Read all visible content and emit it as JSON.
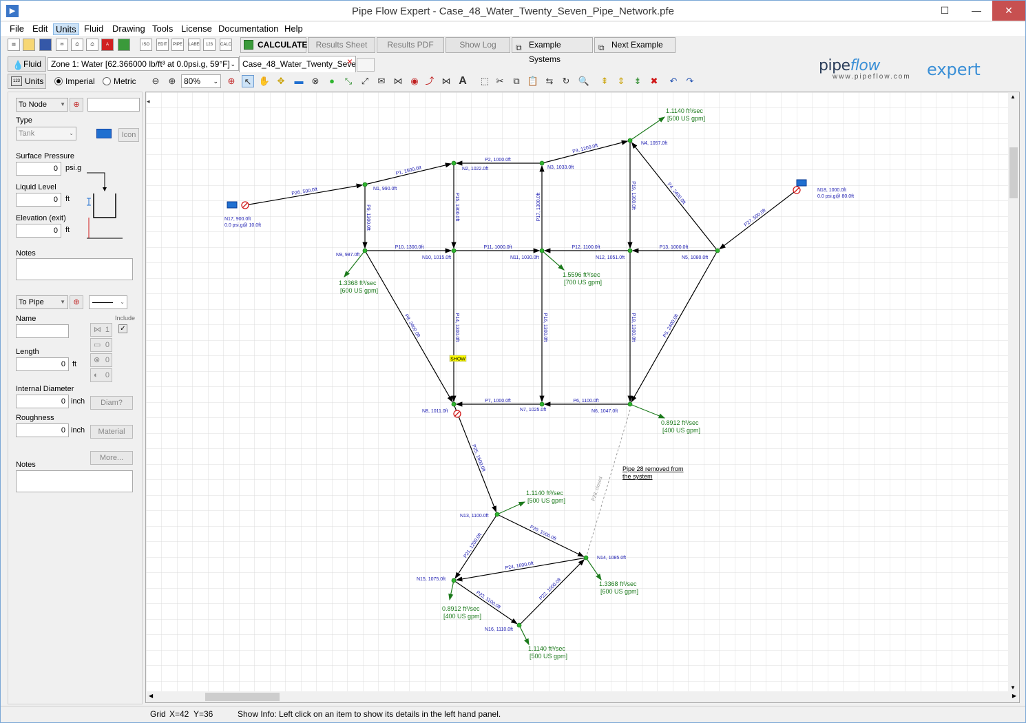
{
  "window": {
    "title": "Pipe Flow Expert - Case_48_Water_Twenty_Seven_Pipe_Network.pfe"
  },
  "menu": [
    {
      "label": "File"
    },
    {
      "label": "Edit"
    },
    {
      "label": "Units"
    },
    {
      "label": "Fluid"
    },
    {
      "label": "Drawing"
    },
    {
      "label": "Tools"
    },
    {
      "label": "License"
    },
    {
      "label": "Documentation"
    },
    {
      "label": "Help"
    }
  ],
  "toolbar": {
    "icons": [
      "new-icon",
      "open-icon",
      "save-icon",
      "email-icon",
      "print-preview-icon",
      "print-icon",
      "pdf-icon",
      "export-icon",
      "iso-icon",
      "edit-icon",
      "pipe-icon",
      "label-icon",
      "number-icon",
      "calc-icon"
    ],
    "icon_texts": {
      "iso": "ISO",
      "edit": "EDIT",
      "pipe": "PIPE",
      "label": "LABEL",
      "num": "123",
      "calc": "CALC"
    },
    "calculate": "CALCULATE",
    "results_sheet": "Results Sheet",
    "results_pdf": "Results PDF",
    "show_log": "Show Log",
    "example_systems": "Example Systems",
    "next_example": "Next Example"
  },
  "fluid": {
    "button": "Fluid",
    "zone": "Zone 1: Water [62.366000 lb/ft³ at 0.0psi.g, 59°F]"
  },
  "tab": {
    "label": "Case_48_Water_Twenty_Seve"
  },
  "units": {
    "button": "Units",
    "imperial": "Imperial",
    "metric": "Metric",
    "zoom": "80%"
  },
  "logo": {
    "pipe": "pipe",
    "flow": "flow",
    "expert": "expert",
    "url": "www.pipeflow.com"
  },
  "node_panel": {
    "to_node": "To Node",
    "type_label": "Type",
    "type_value": "Tank",
    "icon_button": "Icon",
    "surface_pressure_label": "Surface Pressure",
    "surface_pressure": "0",
    "surface_pressure_unit": "psi.g",
    "liquid_level_label": "Liquid Level",
    "liquid_level": "0",
    "liquid_level_unit": "ft",
    "elevation_label": "Elevation (exit)",
    "elevation": "0",
    "elevation_unit": "ft",
    "notes_label": "Notes"
  },
  "pipe_panel": {
    "to_pipe": "To Pipe",
    "name_label": "Name",
    "include_label": "Include",
    "length_label": "Length",
    "length": "0",
    "length_unit": "ft",
    "diameter_label": "Internal Diameter",
    "diameter": "0",
    "diameter_unit": "inch",
    "diam_button": "Diam?",
    "roughness_label": "Roughness",
    "roughness": "0",
    "roughness_unit": "inch",
    "material_button": "Material",
    "more_button": "More...",
    "notes_label": "Notes",
    "counts": [
      "1",
      "0",
      "0",
      "0"
    ]
  },
  "status": {
    "grid": "Grid",
    "x": "X=42",
    "y": "Y=36",
    "info": "Show Info: Left click on an item to show its details in the left hand panel."
  },
  "network": {
    "nodes": [
      {
        "id": "N1",
        "label": "N1, 990.0ft"
      },
      {
        "id": "N2",
        "label": "N2, 1022.0ft"
      },
      {
        "id": "N3",
        "label": "N3, 1033.0ft"
      },
      {
        "id": "N4",
        "label": "N4, 1057.0ft"
      },
      {
        "id": "N5",
        "label": "N5, 1080.0ft"
      },
      {
        "id": "N6",
        "label": "N6, 1047.0ft"
      },
      {
        "id": "N7",
        "label": "N7, 1025.0ft"
      },
      {
        "id": "N8",
        "label": "N8, 1011.0ft"
      },
      {
        "id": "N9",
        "label": "N9, 987.0ft"
      },
      {
        "id": "N10",
        "label": "N10, 1015.0ft"
      },
      {
        "id": "N11",
        "label": "N11, 1030.0ft"
      },
      {
        "id": "N12",
        "label": "N12, 1051.0ft"
      },
      {
        "id": "N13",
        "label": "N13, 1100.0ft"
      },
      {
        "id": "N14",
        "label": "N14, 1085.0ft"
      },
      {
        "id": "N15",
        "label": "N15, 1075.0ft"
      },
      {
        "id": "N16",
        "label": "N16, 1110.0ft"
      },
      {
        "id": "N17",
        "label": "N17, 900.0ft",
        "sub": "0.0 psi.g@ 10.0ft"
      },
      {
        "id": "N18",
        "label": "N18, 1000.0ft",
        "sub": "0.0 psi.g@ 80.0ft"
      }
    ],
    "pipes": [
      {
        "label": "P1, 1500.0ft"
      },
      {
        "label": "P2, 1000.0ft"
      },
      {
        "label": "P3, 1200.0ft"
      },
      {
        "label": "P4, 2400.0ft"
      },
      {
        "label": "P5, 2400.0ft"
      },
      {
        "label": "P6, 1100.0ft"
      },
      {
        "label": "P7, 1000.0ft"
      },
      {
        "label": "P8, 2400.0ft"
      },
      {
        "label": "P9, 1300.0ft"
      },
      {
        "label": "P10, 1300.0ft"
      },
      {
        "label": "P11, 1000.0ft"
      },
      {
        "label": "P12, 1100.0ft"
      },
      {
        "label": "P13, 1000.0ft"
      },
      {
        "label": "P14, 1300.0ft"
      },
      {
        "label": "P15, 1300.0ft"
      },
      {
        "label": "P16, 1300.0ft"
      },
      {
        "label": "P17, 1300.0ft"
      },
      {
        "label": "P18, 1300.0ft"
      },
      {
        "label": "P19, 1300.0ft"
      },
      {
        "label": "P20, 1000.0ft"
      },
      {
        "label": "P21, 1200.0ft"
      },
      {
        "label": "P22, 1000.0ft"
      },
      {
        "label": "P23, 1100.0ft"
      },
      {
        "label": "P24, 1600.0ft"
      },
      {
        "label": "P25, 1600.0ft"
      },
      {
        "label": "P26, 500.0ft"
      },
      {
        "label": "P27, 500.0ft"
      },
      {
        "label": "P28, closed"
      }
    ],
    "demands": [
      {
        "line1": "1.1140 ft³/sec",
        "line2": "[500 US gpm]"
      },
      {
        "line1": "1.3368 ft³/sec",
        "line2": "[600 US gpm]"
      },
      {
        "line1": "1.5596 ft³/sec",
        "line2": "[700 US gpm]"
      },
      {
        "line1": "0.8912 ft³/sec",
        "line2": "[400 US gpm]"
      },
      {
        "line1": "1.1140 ft³/sec",
        "line2": "[500 US gpm]"
      },
      {
        "line1": "1.3368 ft³/sec",
        "line2": "[600 US gpm]"
      },
      {
        "line1": "0.8912 ft³/sec",
        "line2": "[400 US gpm]"
      },
      {
        "line1": "1.1140 ft³/sec",
        "line2": "[500 US gpm]"
      }
    ],
    "show_tag": "SHOW",
    "note": {
      "line1": "Pipe 28 removed from",
      "line2": "the system"
    },
    "colors": {
      "pipe": "#000000",
      "demand": "#1c7a1c",
      "node": "#2fb52f",
      "label": "#1a1ab0",
      "tank": "#1f6fd0",
      "pump": "#d01818",
      "show": "#ffff00"
    }
  }
}
